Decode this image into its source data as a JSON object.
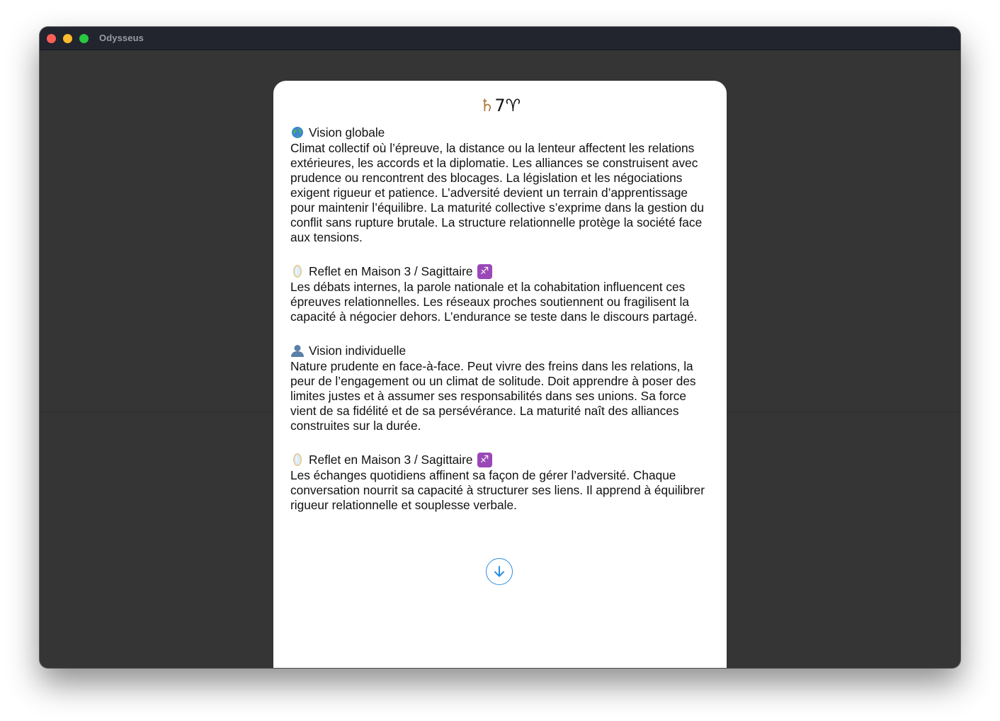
{
  "window": {
    "title": "Odysseus"
  },
  "card": {
    "glyphs": {
      "saturn": "♄",
      "number": "7",
      "aries": "♈"
    },
    "sections": [
      {
        "icon": "globe-icon",
        "title": "Vision globale",
        "body": "Climat collectif où l’épreuve, la distance ou la lenteur affectent les relations extérieures, les accords et la diplomatie. Les alliances se construisent avec prudence ou rencontrent des blocages. La législation et les négociations exigent rigueur et patience. L’adversité devient un terrain d’apprentissage pour maintenir l’équilibre. La maturité collective s’exprime dans la gestion du conflit sans rupture brutale. La structure relationnelle protège la société face aux tensions."
      },
      {
        "icon": "mirror-icon",
        "title": "Reflet en Maison 3 / Sagittaire",
        "badge": "♐",
        "body": "Les débats internes, la parole nationale et la cohabitation influencent ces épreuves relationnelles. Les réseaux proches soutiennent ou fragilisent la capacité à négocier dehors. L’endurance se teste dans le discours partagé."
      },
      {
        "icon": "person-icon",
        "title": "Vision individuelle",
        "body": "Nature prudente en face-à-face. Peut vivre des freins dans les relations, la peur de l’engagement ou un climat de solitude. Doit apprendre à poser des limites justes et à assumer ses responsabilités dans ses unions. Sa force vient de sa fidélité et de sa persévérance. La maturité naît des alliances construites sur la durée."
      },
      {
        "icon": "mirror-icon",
        "title": "Reflet en Maison 3 / Sagittaire",
        "badge": "♐",
        "body": "Les échanges quotidiens affinent sa façon de gérer l’adversité. Chaque conversation nourrit sa capacité à structurer ses liens. Il apprend à équilibrer rigueur relationnelle et souplesse verbale."
      }
    ],
    "scroll_button": {
      "icon": "arrow-down-icon"
    }
  },
  "colors": {
    "accent": "#2d8de0",
    "saturn_glyph": "#b07a3b",
    "sagittarius_badge": "#9a48b8",
    "window_bg": "#353535",
    "titlebar_bg": "#22242e"
  }
}
